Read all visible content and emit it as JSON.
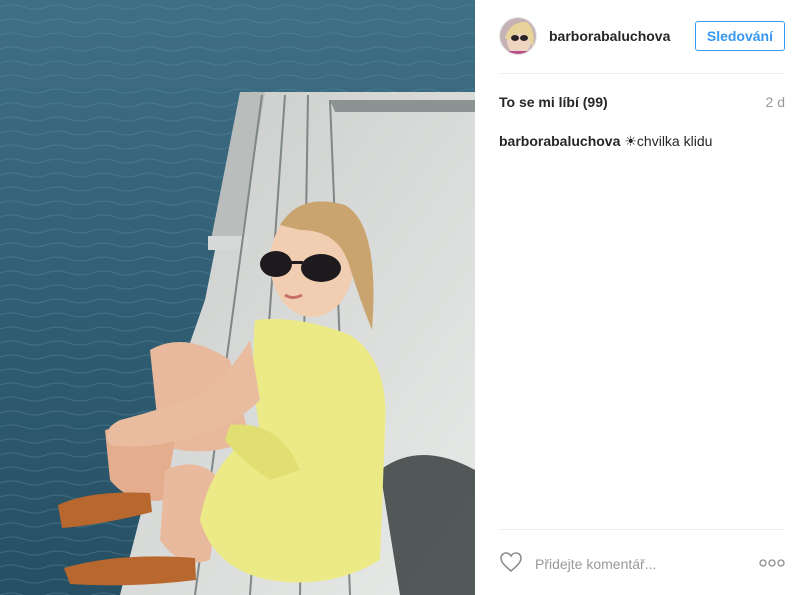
{
  "post": {
    "username": "barborabaluchova",
    "follow_label": "Sledování",
    "likes": "To se mi líbí (99)",
    "age": "2 d",
    "caption_user": "barborabaluchova",
    "caption_text": "☀chvilka klidu",
    "comment_placeholder": "Přidejte komentář..."
  },
  "icons": {
    "like": "heart-outline-icon",
    "more": "ellipsis-icon"
  },
  "colors": {
    "accent": "#3897f0",
    "text": "#262626",
    "muted": "#999999",
    "divider": "#efefef"
  }
}
